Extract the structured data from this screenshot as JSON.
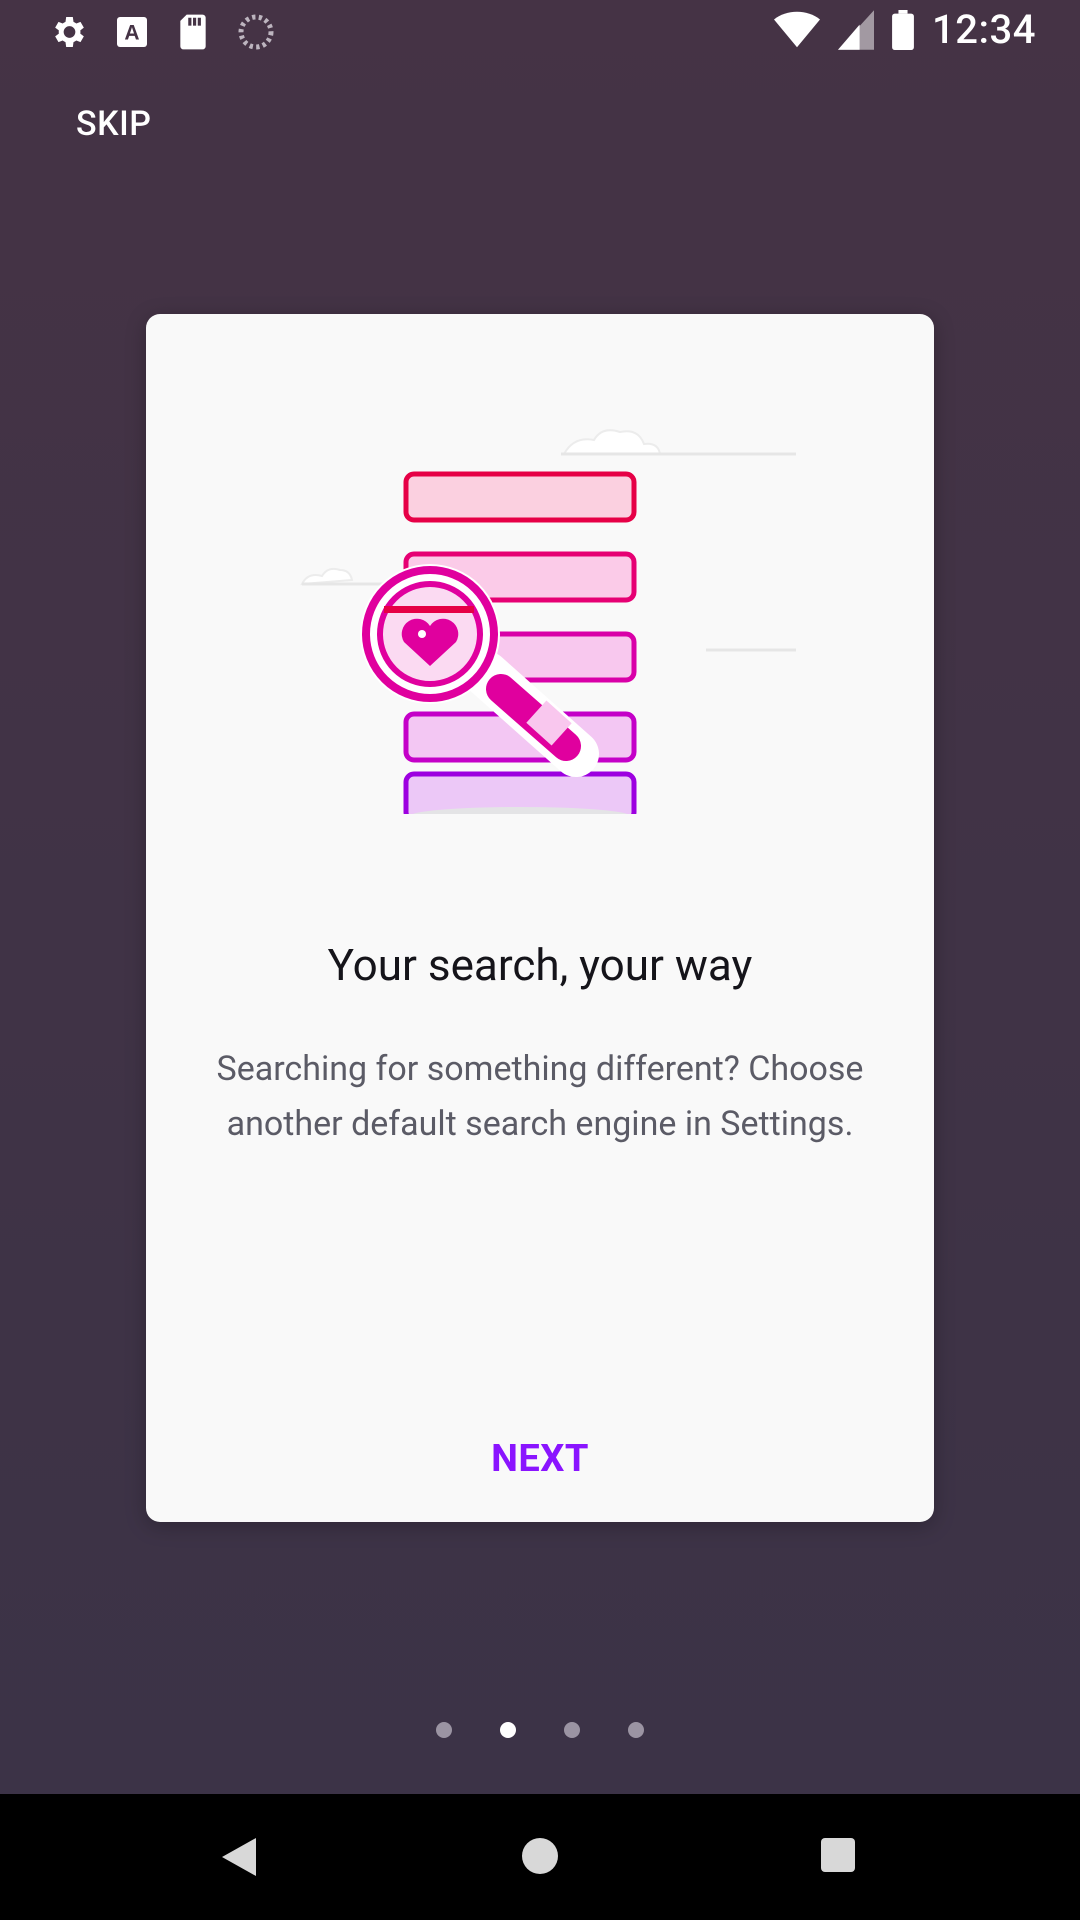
{
  "status_bar": {
    "time": "12:34",
    "left_icons": [
      "gear-icon",
      "text-a-icon",
      "sd-card-icon",
      "loading-icon"
    ],
    "right_icons": [
      "wifi-icon",
      "signal-icon",
      "battery-icon"
    ]
  },
  "header": {
    "skip_label": "SKIP"
  },
  "card": {
    "title": "Your search, your way",
    "body": "Searching for something different? Choose another default search engine in Settings.",
    "next_label": "NEXT",
    "accent_color": "#8a14ff"
  },
  "pager": {
    "total": 4,
    "active_index": 1
  },
  "nav_bar": {
    "buttons": [
      "back-icon",
      "home-icon",
      "recents-icon"
    ]
  }
}
